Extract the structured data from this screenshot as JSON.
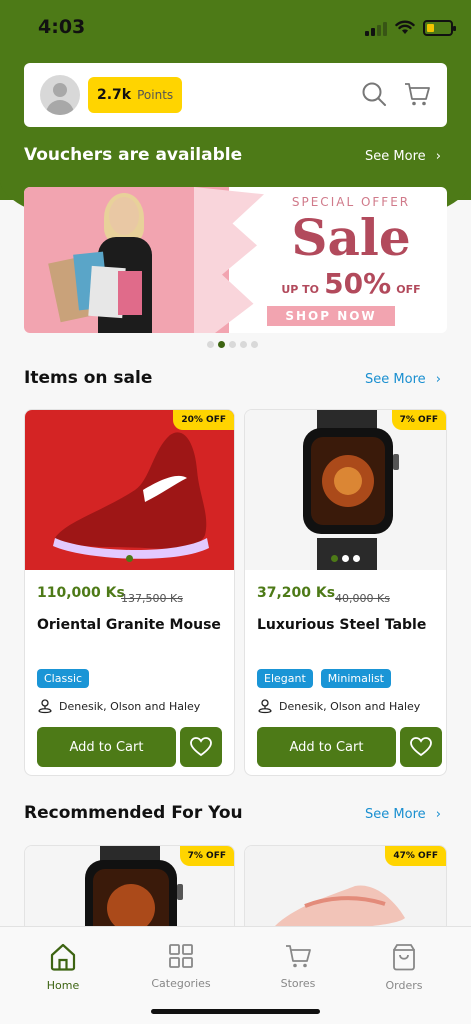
{
  "status_bar": {
    "time": "4:03"
  },
  "header": {
    "points_value": "2.7k",
    "points_label": "Points"
  },
  "vouchers": {
    "title": "Vouchers are available",
    "see_more": "See More"
  },
  "banner": {
    "special": "SPECIAL OFFER",
    "sale": "Sale",
    "upto": "UP TO",
    "percent": "50%",
    "off": "OFF",
    "shop_now": "SHOP NOW",
    "carousel_active_index": 2,
    "carousel_count": 5
  },
  "items_on_sale": {
    "title": "Items on sale",
    "see_more": "See More",
    "products": [
      {
        "discount": "20% OFF",
        "price": "110,000 Ks",
        "old_price": "137,500 Ks",
        "name": "Oriental Granite Mouse",
        "tags": [
          "Classic"
        ],
        "vendor": "Denesik, Olson and Haley",
        "add_to_cart": "Add to Cart"
      },
      {
        "discount": "7% OFF",
        "price": "37,200 Ks",
        "old_price": "40,000 Ks",
        "name": "Luxurious Steel Table",
        "tags": [
          "Elegant",
          "Minimalist"
        ],
        "vendor": "Denesik, Olson and Haley",
        "add_to_cart": "Add to Cart"
      }
    ]
  },
  "recommended": {
    "title": "Recommended For You",
    "see_more": "See More",
    "products": [
      {
        "discount": "7% OFF"
      },
      {
        "discount": "47% OFF"
      }
    ]
  },
  "bottom_nav": {
    "items": [
      {
        "label": "Home",
        "icon": "home-icon",
        "active": true
      },
      {
        "label": "Categories",
        "icon": "grid-icon",
        "active": false
      },
      {
        "label": "Stores",
        "icon": "cart-icon",
        "active": false
      },
      {
        "label": "Orders",
        "icon": "bag-icon",
        "active": false
      }
    ]
  },
  "colors": {
    "brand_green": "#4d7a17",
    "points_yellow": "#ffd400",
    "tag_blue": "#1a95d6",
    "link_blue": "#1a8fd0"
  }
}
